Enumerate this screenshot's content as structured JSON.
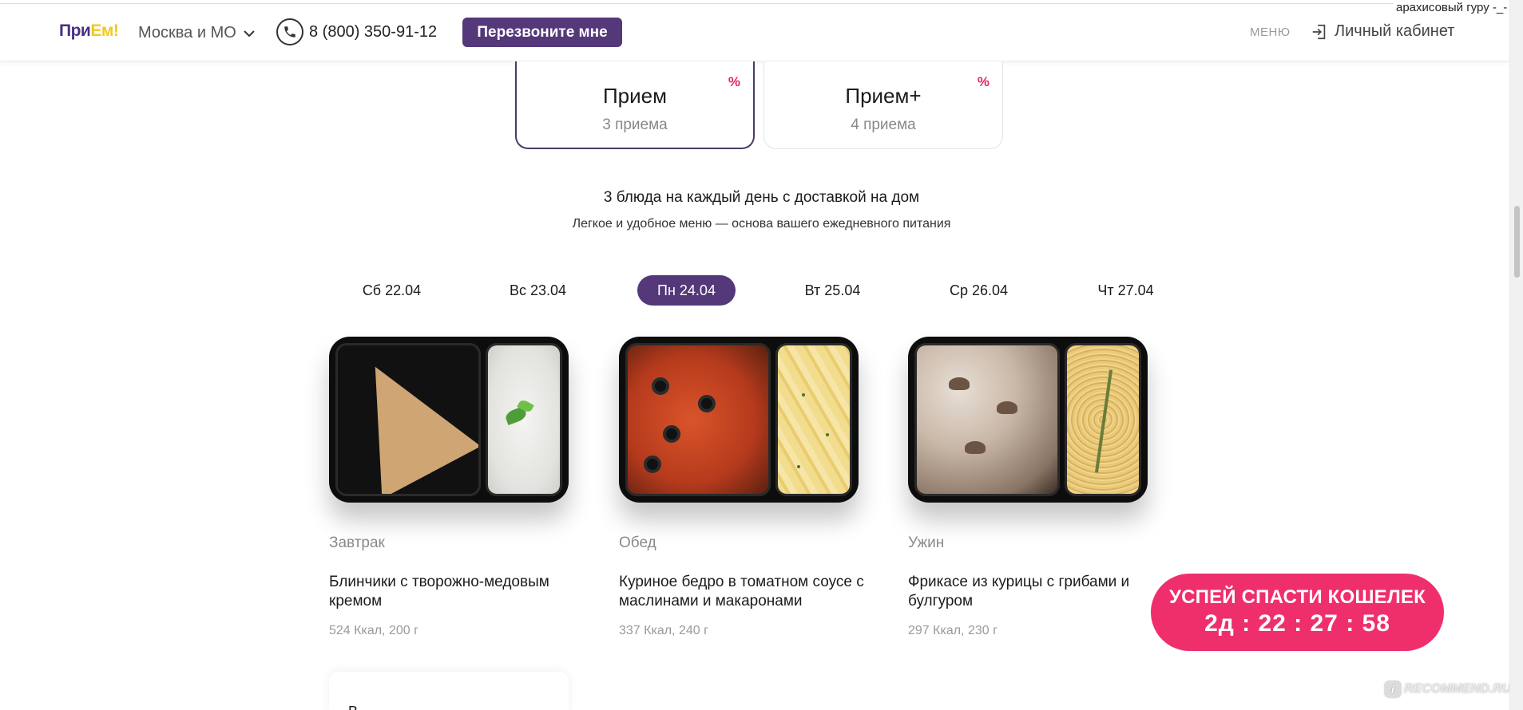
{
  "header": {
    "logo_text": "При",
    "logo_accent": "Ем!",
    "region": "Москва и МО",
    "phone": "8 (800) 350-91-12",
    "callback_label": "Перезвоните мне",
    "menu_label": "МЕНЮ",
    "account_label": "Личный кабинет",
    "corner_user": "арахисовый гуру -_-"
  },
  "plans": [
    {
      "name": "Прием",
      "count": "3 приема",
      "badge": "%",
      "active": true
    },
    {
      "name": "Прием+",
      "count": "4 приема",
      "badge": "%",
      "active": false
    }
  ],
  "intro": {
    "headline": "3 блюда на каждый день с доставкой на дом",
    "subline": "Легкое и удобное меню — основа вашего ежедневного питания"
  },
  "days": [
    {
      "label": "Сб 22.04"
    },
    {
      "label": "Вс 23.04"
    },
    {
      "label": "Пн 24.04"
    },
    {
      "label": "Вт 25.04"
    },
    {
      "label": "Ср 26.04"
    },
    {
      "label": "Чт 27.04"
    }
  ],
  "active_day": "Пн 24.04",
  "dishes": [
    {
      "meal": "Завтрак",
      "name": "Блинчики с творожно-медовым кремом",
      "info": "524 Ккал, 200 г"
    },
    {
      "meal": "Обед",
      "name": "Куриное бедро в томатном соусе с маслинами и макаронами",
      "info": "337 Ккал, 240 г"
    },
    {
      "meal": "Ужин",
      "name": "Фрикасе из курицы с грибами и булгуром",
      "info": "297 Ккал, 230 г"
    }
  ],
  "next_card_text": "В",
  "promo": {
    "title": "УСПЕЙ СПАСТИ КОШЕЛЕК",
    "timer": "2д : 22 : 27 : 58"
  },
  "watermark": "RECOMMEND.RU",
  "colors": {
    "brand_purple": "#54387a",
    "brand_yellow": "#f2c81d",
    "promo_pink": "#ef2f6b",
    "percent_red": "#e0275f"
  },
  "icons": {
    "region_dropdown": "chevron-down-icon",
    "phone": "phone-icon",
    "account": "login-icon"
  }
}
